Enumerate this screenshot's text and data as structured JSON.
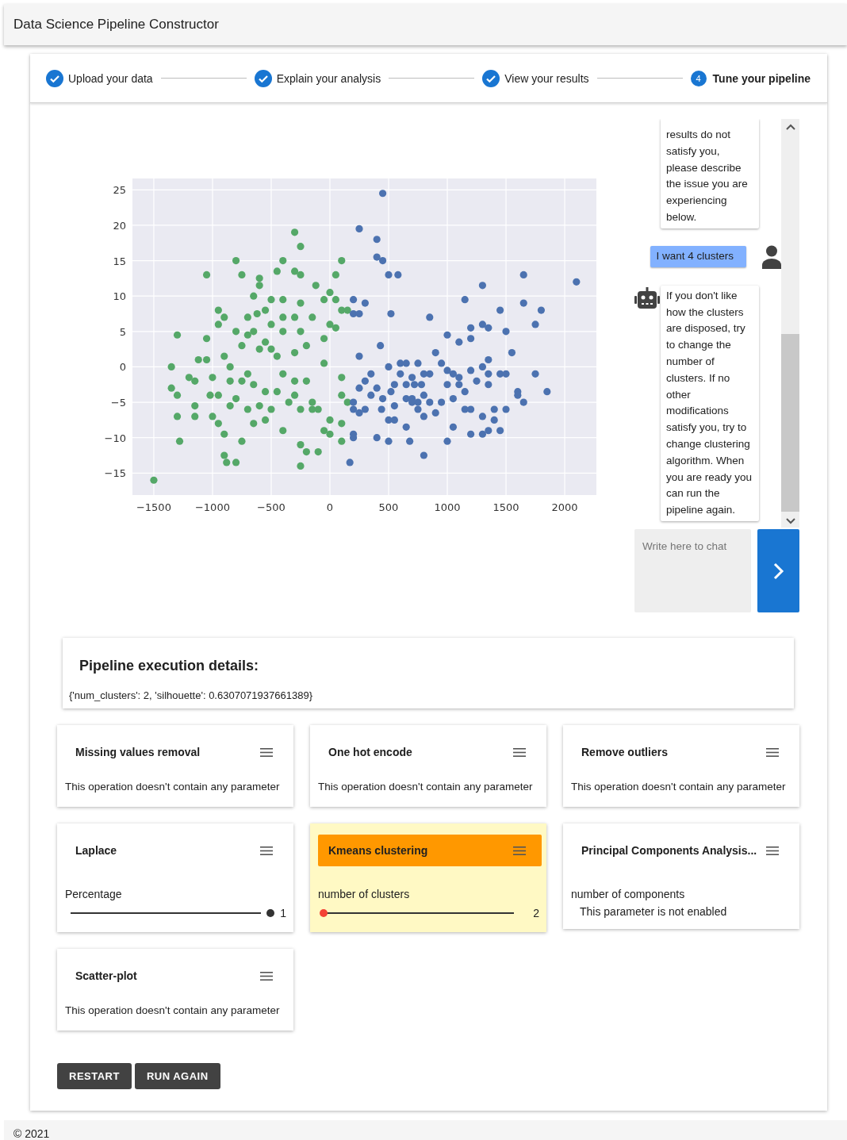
{
  "app_bar": {
    "title": "Data Science Pipeline Constructor"
  },
  "stepper": [
    {
      "label": "Upload your data",
      "completed": true,
      "selected": false
    },
    {
      "label": "Explain your analysis",
      "completed": true,
      "selected": false
    },
    {
      "label": "View your results",
      "completed": true,
      "selected": false
    },
    {
      "label": "Tune your pipeline",
      "completed": false,
      "selected": true,
      "number": "4"
    }
  ],
  "result_plot": {
    "chart_data": {
      "type": "scatter",
      "grid": true,
      "xlim": [
        -1682,
        2270
      ],
      "ylim": [
        -18.1,
        26.6
      ],
      "xticks": [
        {
          "value": -1500,
          "label": "−1500"
        },
        {
          "value": -1000,
          "label": "−1000"
        },
        {
          "value": -500,
          "label": "−500"
        },
        0,
        500,
        1000,
        1500,
        2000
      ],
      "yticks": [
        {
          "value": -15,
          "label": "−15"
        },
        {
          "value": -10,
          "label": "−10"
        },
        {
          "value": -5,
          "label": "−5"
        },
        0,
        5,
        10,
        15,
        20,
        25
      ],
      "series": [
        {
          "color": "#55a868",
          "x": [
            -1500,
            -1350,
            -1350,
            -1300,
            -1300,
            -1300,
            -1280,
            -1200,
            -1150,
            -1150,
            -1150,
            -1120,
            -1050,
            -1050,
            -1050,
            -1000,
            -1020,
            -1000,
            -950,
            -950,
            -950,
            -950,
            -900,
            -900,
            -900,
            -900,
            -880,
            -850,
            -850,
            -850,
            -800,
            -800,
            -800,
            -800,
            -750,
            -750,
            -750,
            -750,
            -700,
            -700,
            -700,
            -700,
            -650,
            -650,
            -650,
            -650,
            -620,
            -600,
            -600,
            -600,
            -600,
            -550,
            -550,
            -550,
            -550,
            -500,
            -500,
            -500,
            -500,
            -450,
            -450,
            -450,
            -400,
            -400,
            -400,
            -400,
            -400,
            -400,
            -350,
            -300,
            -300,
            -300,
            -300,
            -300,
            -300,
            -250,
            -250,
            -250,
            -250,
            -250,
            -250,
            -250,
            -200,
            -200,
            -200,
            -150,
            -150,
            -150,
            -120,
            -100,
            -100,
            -50,
            -50,
            -50,
            -50,
            0,
            0,
            0,
            0,
            50,
            50,
            50,
            100,
            100,
            100,
            100,
            100,
            100,
            150,
            150
          ],
          "values": [
            -16,
            0,
            -3,
            4.5,
            -4,
            -7,
            -10.5,
            -1.5,
            -2,
            -5.5,
            -7,
            1,
            13,
            1,
            4,
            -1.5,
            -4,
            -7,
            8,
            6,
            -4,
            -8,
            7,
            1.5,
            -9.5,
            -12.5,
            -13.5,
            0,
            -2,
            -5.5,
            15,
            5,
            -4.5,
            -13.5,
            13,
            3,
            -2,
            -10.5,
            7,
            4.5,
            -1,
            -6,
            10,
            5,
            -2.5,
            -8,
            7.5,
            12.5,
            11.5,
            2.5,
            -5.5,
            8,
            3.5,
            -3.5,
            -7.5,
            9.5,
            6,
            2.5,
            -6,
            13.5,
            1.5,
            -3.5,
            15,
            9.5,
            7,
            5,
            -1,
            -9,
            -5,
            19,
            13.5,
            7,
            2,
            -2,
            -4,
            17,
            13,
            9,
            5,
            -6,
            -11,
            -14,
            3,
            -2,
            -12,
            7,
            -5,
            -6,
            11.5,
            -6,
            -12,
            9.5,
            4,
            0.5,
            -9,
            10.5,
            6,
            -7.5,
            -9.5,
            13,
            9.5,
            5.5,
            15,
            8,
            -1.5,
            -4,
            -8,
            -10.5,
            8,
            -5
          ]
        },
        {
          "color": "#4c72b0",
          "x": [
            450,
            250,
            400,
            400,
            450,
            500,
            580,
            200,
            200,
            250,
            300,
            520,
            850,
            1150,
            1300,
            1650,
            2100,
            1650,
            1450,
            1800,
            1750,
            1300,
            1350,
            1200,
            1500,
            1000,
            1100,
            1200,
            430,
            250,
            1550,
            900,
            500,
            600,
            650,
            750,
            950,
            1350,
            1300,
            350,
            600,
            700,
            800,
            850,
            1000,
            1050,
            1100,
            1200,
            1350,
            1450,
            1500,
            1750,
            300,
            250,
            400,
            550,
            650,
            720,
            780,
            1000,
            1100,
            1250,
            1350,
            1600,
            1850,
            200,
            350,
            450,
            520,
            650,
            700,
            750,
            800,
            850,
            950,
            1050,
            1150,
            1600,
            1650,
            200,
            250,
            300,
            440,
            500,
            550,
            550,
            700,
            750,
            800,
            900,
            1150,
            1200,
            1300,
            1400,
            1500,
            1400,
            650,
            1050,
            1350,
            1450,
            200,
            200,
            400,
            500,
            680,
            1000,
            1200,
            1300,
            800,
            170
          ],
          "values": [
            24.5,
            19.5,
            18,
            15.5,
            15,
            13,
            13,
            9.5,
            7.5,
            7.5,
            9,
            7.5,
            7,
            9.5,
            11.5,
            13,
            12,
            9,
            8,
            8,
            6,
            6,
            5.5,
            5.5,
            5,
            4.5,
            3.5,
            4,
            3,
            1.5,
            2,
            2,
            0,
            0.5,
            0.5,
            0.5,
            0.5,
            1,
            0,
            -1,
            -1,
            -1.5,
            -1,
            -1,
            -0.5,
            -1,
            -1.5,
            -0.5,
            -1,
            -1,
            -1,
            -1,
            -2,
            -3,
            -3,
            -2.5,
            -2.5,
            -2.5,
            -2.5,
            -2.5,
            -2.5,
            -2,
            -2.5,
            -3.5,
            -3.5,
            -5,
            -4,
            -4.5,
            -3.5,
            -4.5,
            -4.5,
            -5,
            -4,
            -5,
            -5,
            -4.5,
            -3.5,
            -4,
            -5,
            -6,
            -6.5,
            -6,
            -6,
            -7.5,
            -7.5,
            -5.5,
            -5,
            -6,
            -7,
            -6.5,
            -6,
            -6,
            -7,
            -6,
            -6,
            -7.5,
            -8.5,
            -8.5,
            -9,
            -9,
            -9.5,
            -10,
            -10,
            -10.5,
            -10.5,
            -10.5,
            -9.5,
            -9.5,
            -12.5,
            -13.5
          ]
        }
      ]
    }
  },
  "chat": {
    "messages": [
      {
        "kind": "bot",
        "avatar": false,
        "text": "results do not satisfy you, please describe the issue you are experiencing below."
      },
      {
        "kind": "user",
        "avatar": true,
        "text": "I want 4 clusters"
      },
      {
        "kind": "bot",
        "avatar": true,
        "text": "If you don't like how the clusters are disposed, try to change the number of clusters. If no other modifications satisfy you, try to change clustering algorithm. When you are ready you can run the pipeline again."
      }
    ],
    "input": {
      "placeholder": "Write here to chat"
    }
  },
  "execution_details": {
    "title": "Pipeline execution details:",
    "text": "{'num_clusters': 2, 'silhouette': 0.6307071937661389}"
  },
  "operations": [
    {
      "title": "Missing values removal",
      "selected": false,
      "kind": "none",
      "text": "This operation doesn't contain any parameter"
    },
    {
      "title": "One hot encode",
      "selected": false,
      "kind": "none",
      "text": "This operation doesn't contain any parameter"
    },
    {
      "title": "Remove outliers",
      "selected": false,
      "kind": "none",
      "text": "This operation doesn't contain any parameter"
    },
    {
      "title": "Laplace",
      "selected": false,
      "kind": "slider",
      "label": "Percentage",
      "level": 1,
      "value": "1"
    },
    {
      "title": "Kmeans clustering",
      "selected": true,
      "kind": "slider",
      "label": "number of clusters",
      "level": 0,
      "value": "2"
    },
    {
      "title": "Principal Components Analysis...",
      "selected": false,
      "kind": "disabled",
      "label": "number of components",
      "text": "This parameter is not enabled"
    },
    {
      "title": "Scatter-plot",
      "selected": false,
      "kind": "none",
      "text": "This operation doesn't contain any parameter"
    }
  ],
  "buttons": [
    "RESTART",
    "RUN AGAIN"
  ],
  "footer": {
    "text": "© 2021"
  }
}
